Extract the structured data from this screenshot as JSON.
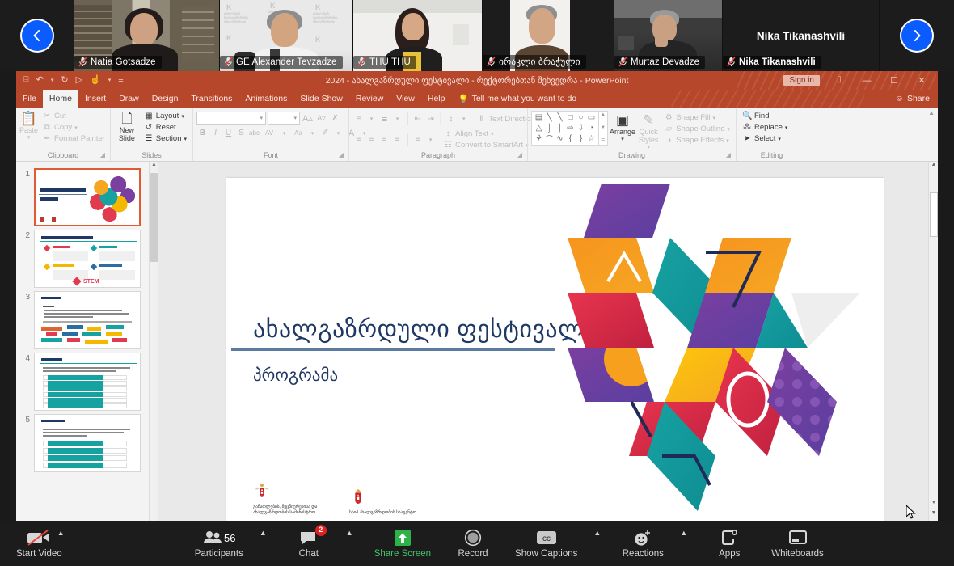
{
  "meeting": {
    "prev_arrow": "‹",
    "next_arrow": "›",
    "tiles": [
      {
        "name": "Natia Gotsadze",
        "scene": "library",
        "muted": true
      },
      {
        "name": "GE Alexander Tevzadze",
        "scene": "office",
        "muted": true
      },
      {
        "name": "THU THU",
        "scene": "room",
        "muted": true
      },
      {
        "name": "ირაკლი ბრაჭული",
        "scene": "wall",
        "muted": true
      },
      {
        "name": "Murtaz Devadze",
        "scene": "dark",
        "muted": true
      },
      {
        "name": "Nika Tikanashvili",
        "scene": "black",
        "muted": true,
        "name_only_big": "Nika Tikanashvili"
      }
    ]
  },
  "powerpoint": {
    "title": "2024 - ახალგაზრდული ფესტივალი - რექტორებთან შეხვედრა  -  PowerPoint",
    "sign_in": "Sign in",
    "share": "Share",
    "share_icon": "person-add-icon",
    "quick_access": [
      {
        "name": "save-icon",
        "glyph": "⌸"
      },
      {
        "name": "undo-icon",
        "glyph": "↶"
      },
      {
        "name": "undo-dropdown-icon",
        "glyph": "▾"
      },
      {
        "name": "redo-icon",
        "glyph": "↻"
      },
      {
        "name": "start-slideshow-icon",
        "glyph": "▷"
      },
      {
        "name": "touch-mode-icon",
        "glyph": "☝"
      },
      {
        "name": "touch-dropdown-icon",
        "glyph": "▾"
      },
      {
        "name": "customize-qat-icon",
        "glyph": "≡"
      }
    ],
    "window_controls": [
      {
        "name": "ribbon-display-options-icon",
        "glyph": "⌷"
      },
      {
        "name": "minimize-icon",
        "glyph": "—"
      },
      {
        "name": "restore-icon",
        "glyph": "☐"
      },
      {
        "name": "close-icon",
        "glyph": "✕"
      }
    ],
    "tabs": [
      {
        "label": "File",
        "active": false
      },
      {
        "label": "Home",
        "active": true
      },
      {
        "label": "Insert",
        "active": false
      },
      {
        "label": "Draw",
        "active": false
      },
      {
        "label": "Design",
        "active": false
      },
      {
        "label": "Transitions",
        "active": false
      },
      {
        "label": "Animations",
        "active": false
      },
      {
        "label": "Slide Show",
        "active": false
      },
      {
        "label": "Review",
        "active": false
      },
      {
        "label": "View",
        "active": false
      },
      {
        "label": "Help",
        "active": false
      }
    ],
    "tell_me": "Tell me what you want to do",
    "tell_me_icon": "lightbulb-icon",
    "ribbon": {
      "clipboard": {
        "label": "Clipboard",
        "paste": "Paste",
        "paste_icon": "clipboard-icon",
        "items": [
          {
            "label": "Cut",
            "icon": "scissors-icon",
            "glyph": "✂"
          },
          {
            "label": "Copy",
            "icon": "copy-icon",
            "glyph": "⧉"
          },
          {
            "label": "Format Painter",
            "icon": "format-painter-icon",
            "glyph": "🖌"
          }
        ]
      },
      "slides": {
        "label": "Slides",
        "new_slide": "New Slide",
        "new_slide_icon": "new-slide-icon",
        "items": [
          {
            "label": "Layout",
            "icon": "layout-icon",
            "glyph": "▦"
          },
          {
            "label": "Reset",
            "icon": "reset-icon",
            "glyph": "↺"
          },
          {
            "label": "Section",
            "icon": "section-icon",
            "glyph": "☰"
          }
        ]
      },
      "font": {
        "label": "Font",
        "font_name_value": "",
        "font_size_value": "",
        "buttons": [
          {
            "name": "grow-font-icon",
            "glyph": "A▴"
          },
          {
            "name": "shrink-font-icon",
            "glyph": "A▾"
          },
          {
            "name": "clear-formatting-icon",
            "glyph": "⌫"
          },
          {
            "name": "bold-icon",
            "glyph": "B"
          },
          {
            "name": "italic-icon",
            "glyph": "I"
          },
          {
            "name": "underline-icon",
            "glyph": "U"
          },
          {
            "name": "text-shadow-icon",
            "glyph": "S"
          },
          {
            "name": "strikethrough-icon",
            "glyph": "abc"
          },
          {
            "name": "character-spacing-icon",
            "glyph": "AV"
          },
          {
            "name": "change-case-icon",
            "glyph": "Aa"
          },
          {
            "name": "text-highlight-icon",
            "glyph": "✐"
          },
          {
            "name": "font-color-icon",
            "glyph": "A"
          }
        ]
      },
      "paragraph": {
        "label": "Paragraph",
        "items": [
          {
            "label": "Text Direction",
            "icon": "text-direction-icon",
            "glyph": "‖A"
          },
          {
            "label": "Align Text",
            "icon": "align-text-icon",
            "glyph": "↕"
          },
          {
            "label": "Convert to SmartArt",
            "icon": "smartart-icon",
            "glyph": "☷"
          }
        ],
        "buttons": [
          {
            "name": "bullets-icon",
            "glyph": "☰"
          },
          {
            "name": "numbering-icon",
            "glyph": "☷"
          },
          {
            "name": "decrease-indent-icon",
            "glyph": "←"
          },
          {
            "name": "increase-indent-icon",
            "glyph": "→"
          },
          {
            "name": "line-spacing-icon",
            "glyph": "↕"
          },
          {
            "name": "align-left-icon",
            "glyph": "≡"
          },
          {
            "name": "align-center-icon",
            "glyph": "≡"
          },
          {
            "name": "align-right-icon",
            "glyph": "≡"
          },
          {
            "name": "justify-icon",
            "glyph": "≡"
          },
          {
            "name": "columns-icon",
            "glyph": "‖"
          }
        ]
      },
      "drawing": {
        "label": "Drawing",
        "arrange": "Arrange",
        "arrange_icon": "arrange-icon",
        "quick_styles": "Quick Styles",
        "quick_styles_icon": "quick-styles-icon",
        "items": [
          {
            "label": "Shape Fill",
            "icon": "shape-fill-icon",
            "glyph": "🪣"
          },
          {
            "label": "Shape Outline",
            "icon": "shape-outline-icon",
            "glyph": "▱"
          },
          {
            "label": "Shape Effects",
            "icon": "shape-effects-icon",
            "glyph": "◑"
          }
        ],
        "shape_glyphs": [
          "▤",
          "╲",
          "╲",
          "□",
          "○",
          "▭",
          "△",
          "⌐",
          "⌙",
          "⇨",
          "⇩",
          "◔",
          "⚘",
          "⌒",
          "∿",
          "{",
          "}",
          "☆"
        ]
      },
      "editing": {
        "label": "Editing",
        "items": [
          {
            "label": "Find",
            "icon": "search-icon",
            "glyph": "🔍"
          },
          {
            "label": "Replace",
            "icon": "replace-icon",
            "glyph": "⁂"
          },
          {
            "label": "Select",
            "icon": "select-icon",
            "glyph": "➤"
          }
        ]
      }
    },
    "thumbnails": [
      {
        "number": "1",
        "selected": true,
        "kind": "title"
      },
      {
        "number": "2",
        "selected": false,
        "kind": "fourbox"
      },
      {
        "number": "3",
        "selected": false,
        "kind": "tags"
      },
      {
        "number": "4",
        "selected": false,
        "kind": "bars7"
      },
      {
        "number": "5",
        "selected": false,
        "kind": "bars5"
      }
    ],
    "slide": {
      "title": "ახალგაზრდული ფესტივალი",
      "subtitle": "პროგრამა",
      "logos": [
        {
          "name": "ministry-logo",
          "caption": "განათლების, მეცნიერებისა და ახალგაზრდობის სამინისტრო"
        },
        {
          "name": "youth-agency-logo",
          "caption": "სსიპ ახალგაზრდობის სააგენტო"
        }
      ],
      "artwork_name": "hexagon-rhombus-artwork"
    },
    "colors": {
      "ribbon_red": "#b7472a",
      "title_blue": "#1f3864",
      "selected_thumb": "#e05a33"
    }
  },
  "zoom_toolbar": {
    "left": [
      {
        "label": "Start Video",
        "icon": "video-off-icon",
        "name": "start-video-button",
        "caret": true,
        "muted_style": true
      }
    ],
    "center": [
      {
        "label": "Participants",
        "icon": "participants-icon",
        "name": "participants-button",
        "count": "56",
        "caret": true
      },
      {
        "label": "Chat",
        "icon": "chat-icon",
        "name": "chat-button",
        "badge": "2",
        "caret": true
      },
      {
        "label": "Share Screen",
        "icon": "share-screen-icon",
        "name": "share-screen-button",
        "green": true
      },
      {
        "label": "Record",
        "icon": "record-icon",
        "name": "record-button"
      },
      {
        "label": "Show Captions",
        "icon": "closed-captions-icon",
        "name": "show-captions-button",
        "caret": true
      },
      {
        "label": "Reactions",
        "icon": "reactions-icon",
        "name": "reactions-button",
        "caret": true
      },
      {
        "label": "Apps",
        "icon": "apps-icon",
        "name": "apps-button"
      },
      {
        "label": "Whiteboards",
        "icon": "whiteboard-icon",
        "name": "whiteboards-button"
      }
    ]
  }
}
